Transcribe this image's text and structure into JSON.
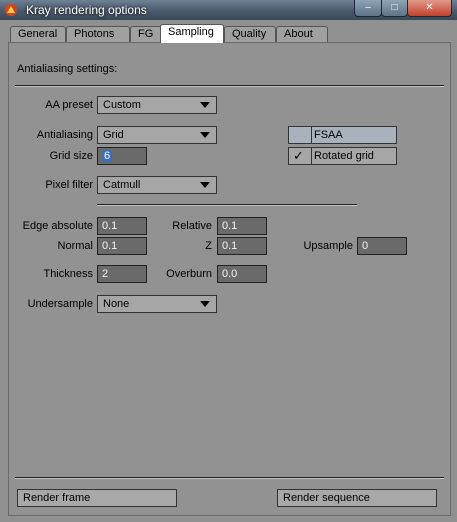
{
  "window": {
    "title": "Kray rendering options",
    "controls": {
      "minimize": "–",
      "maximize": "□",
      "close": "✕"
    }
  },
  "tabs": [
    "General",
    "Photons",
    "FG",
    "Sampling",
    "Quality",
    "About"
  ],
  "active_tab": "Sampling",
  "section": {
    "heading": "Antialiasing settings:"
  },
  "aa_preset": {
    "label": "AA preset",
    "value": "Custom"
  },
  "antialiasing": {
    "label": "Antialiasing",
    "value": "Grid"
  },
  "grid_size": {
    "label": "Grid size",
    "value": "6"
  },
  "fsaa": {
    "label": "FSAA",
    "checked": false
  },
  "rotated_grid": {
    "label": "Rotated grid",
    "checked": true,
    "check_glyph": "✓"
  },
  "pixel_filter": {
    "label": "Pixel filter",
    "value": "Catmull"
  },
  "edge_absolute": {
    "label": "Edge absolute",
    "value": "0.1"
  },
  "relative": {
    "label": "Relative",
    "value": "0.1"
  },
  "normal": {
    "label": "Normal",
    "value": "0.1"
  },
  "z": {
    "label": "Z",
    "value": "0.1"
  },
  "upsample": {
    "label": "Upsample",
    "value": "0"
  },
  "thickness": {
    "label": "Thickness",
    "value": "2"
  },
  "overburn": {
    "label": "Overburn",
    "value": "0.0"
  },
  "undersample": {
    "label": "Undersample",
    "value": "None"
  },
  "footer": {
    "render_frame": "Render frame",
    "render_sequence": "Render sequence"
  },
  "icons": {
    "app": "kray-app-icon",
    "dropdown": "chevron-down-icon",
    "check": "checkmark-icon"
  },
  "colors": {
    "panel": "#929292",
    "field": "#6a6a6a",
    "active_tab": "#ffffff",
    "selection": "#3f6fb0"
  }
}
